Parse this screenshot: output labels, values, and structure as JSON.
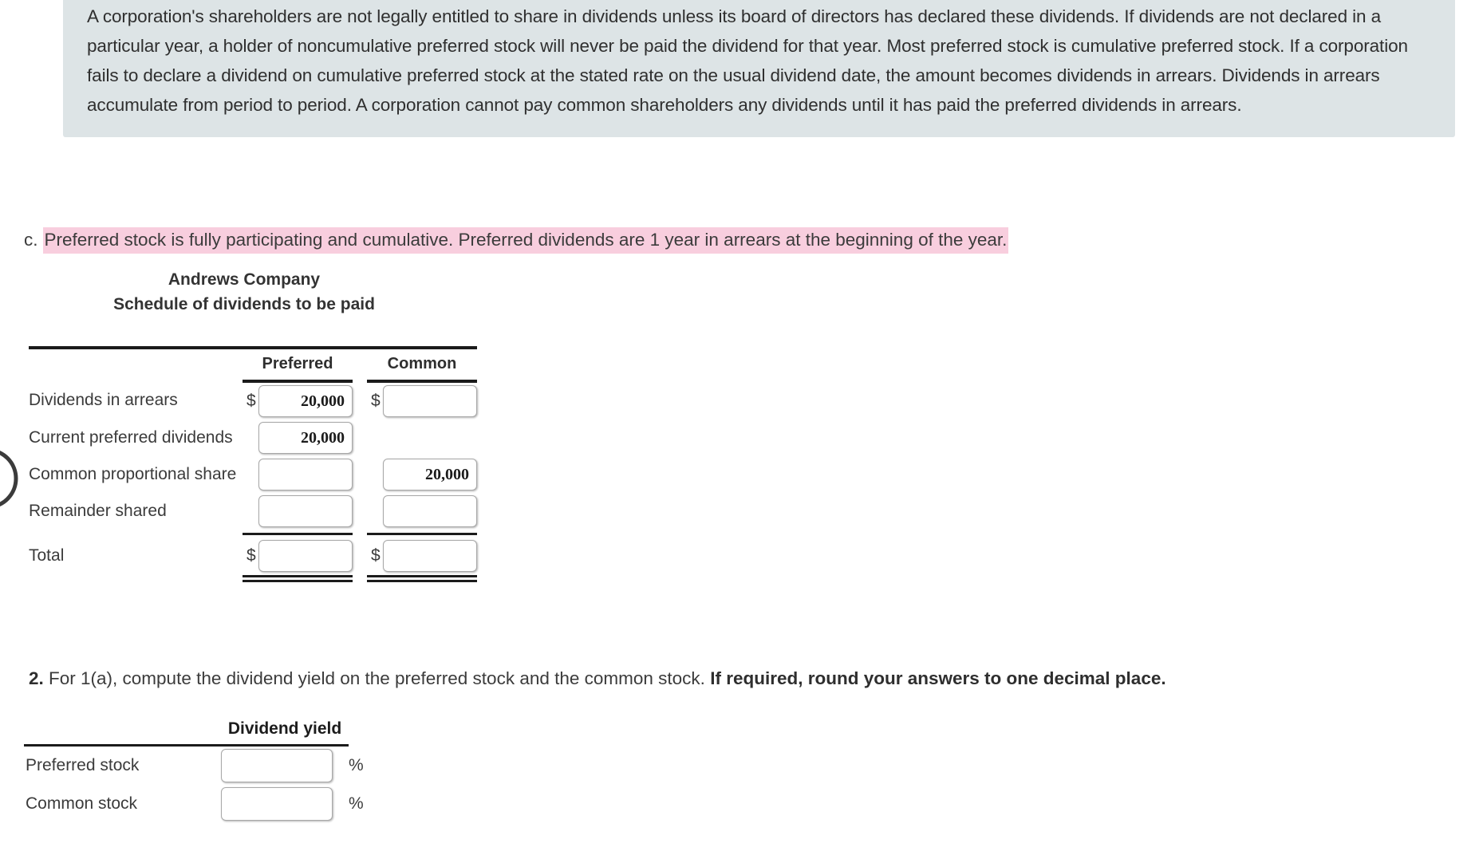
{
  "info_panel": {
    "text": "A corporation's shareholders are not legally entitled to share in dividends unless its board of directors has declared these dividends. If dividends are not declared in a particular year, a holder of noncumulative preferred stock will never be paid the dividend for that year. Most preferred stock is cumulative preferred stock. If a corporation fails to declare a dividend on cumulative preferred stock at the stated rate on the usual dividend date, the amount becomes dividends in arrears. Dividends in arrears accumulate from period to period. A corporation cannot pay common shareholders any dividends until it has paid the preferred dividends in arrears.",
    "background_color": "#dde4e6"
  },
  "part_c": {
    "marker": "c.",
    "highlighted_text": "Preferred stock is fully participating and cumulative. Preferred dividends are 1 year in arrears at the beginning of the year.",
    "highlight_color": "#f8cede"
  },
  "schedule": {
    "company": "Andrews Company",
    "subtitle": "Schedule of dividends to be paid",
    "columns": [
      "Preferred",
      "Common"
    ],
    "rows": [
      {
        "label": "Dividends in arrears",
        "preferred": "20,000",
        "common": "",
        "pref_dollar": true,
        "com_dollar": true
      },
      {
        "label": "Current preferred dividends",
        "preferred": "20,000",
        "common": null,
        "pref_dollar": false,
        "com_dollar": false
      },
      {
        "label": "Common proportional share",
        "preferred": "",
        "common": "20,000",
        "pref_dollar": false,
        "com_dollar": false
      },
      {
        "label": "Remainder shared",
        "preferred": "",
        "common": "",
        "pref_dollar": false,
        "com_dollar": false
      },
      {
        "label": "Total",
        "preferred": "",
        "common": "",
        "pref_dollar": true,
        "com_dollar": true
      }
    ]
  },
  "question2": {
    "number": "2.",
    "text": " For 1(a), compute the dividend yield on the preferred stock and the common stock. ",
    "bold_text": "If required, round your answers to one decimal place."
  },
  "yield_table": {
    "header": "Dividend yield",
    "rows": [
      {
        "label": "Preferred stock",
        "value": "",
        "unit": "%"
      },
      {
        "label": "Common stock",
        "value": "",
        "unit": "%"
      }
    ]
  }
}
